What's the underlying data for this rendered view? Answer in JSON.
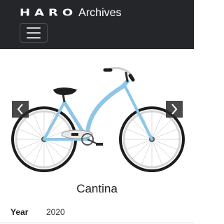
{
  "header": {
    "logo_text": "HARO",
    "logo_sub": "Archives",
    "menu_icon": "hamburger-icon"
  },
  "carousel": {
    "image_icon": "cruiser-bicycle-image",
    "frame_color": "#8ec6e6",
    "prev_icon": "chevron-left-icon",
    "next_icon": "chevron-right-icon"
  },
  "product": {
    "name": "Cantina",
    "specs": [
      {
        "label": "Year",
        "value": "2020"
      }
    ]
  }
}
